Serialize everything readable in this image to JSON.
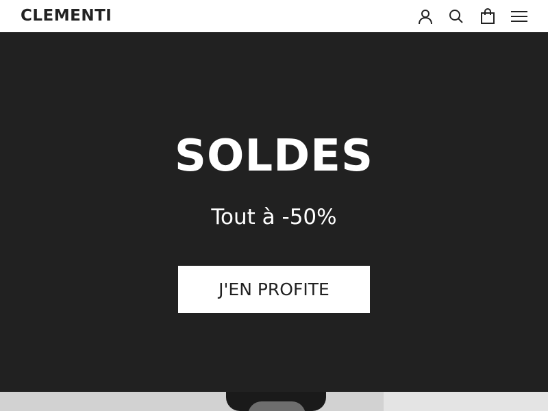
{
  "header": {
    "brand": "CLEMENTI",
    "icons": [
      "account-icon",
      "search-icon",
      "cart-icon",
      "menu-icon"
    ]
  },
  "hero": {
    "title": "SOLDES",
    "subtitle": "Tout à -50%",
    "cta_label": "J'EN PROFITE"
  },
  "colors": {
    "hero_background": "#212121",
    "header_background": "#ffffff",
    "text_dark": "#222222",
    "text_light": "#ffffff"
  }
}
